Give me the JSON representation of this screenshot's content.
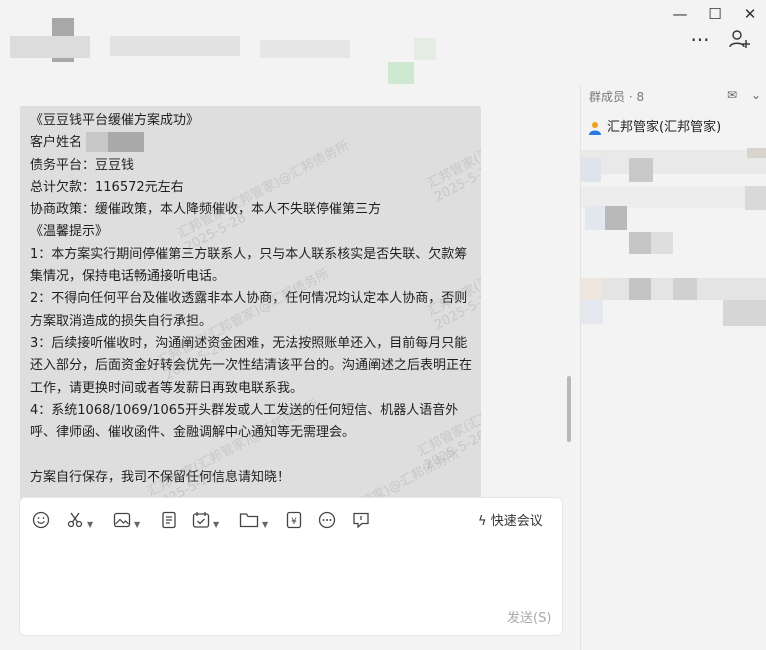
{
  "window": {
    "minimize": "—",
    "maximize": "☐",
    "close": "✕"
  },
  "header": {
    "more": "···",
    "add_member": "+"
  },
  "chat": {
    "lines": [
      "《豆豆钱平台缓催方案成功》",
      "客户姓名",
      "债务平台：豆豆钱",
      "总计欠款：116572元左右",
      "协商政策：缓催政策，本人降频催收，本人不失联停催第三方",
      "《温馨提示》",
      "1：本方案实行期间停催第三方联系人，只与本人联系核实是否失联、欠款筹",
      "集情况，保持电话畅通接听电话。",
      "2：不得向任何平台及催收透露非本人协商，任何情况均认定本人协商，否则",
      "方案取消造成的损失自行承担。",
      "3：后续接听催收时，沟通阐述资金困难，无法按照账单还入，目前每月只能",
      "还入部分，后面资金好转会优先一次性结清该平台的。沟通阐述之后表明正在",
      "工作，请更换时间或者等发薪日再致电联系我。",
      "4：系统1068/1069/1065开头群发或人工发送的任何短信、机器人语音外",
      "呼、律师函、催收函件、金融调解中心通知等无需理会。",
      "",
      "方案自行保存，我司不保留任何信息请知晓！"
    ],
    "watermark_name": "汇邦管家(汇邦管家)@汇邦债务所",
    "watermark_date": "2025-5-28"
  },
  "composer": {
    "meeting_label": "快速会议",
    "send_label": "发送(S)"
  },
  "sidebar": {
    "members_title": "群成员 · 8",
    "member_name": "汇邦管家(汇邦管家)"
  }
}
